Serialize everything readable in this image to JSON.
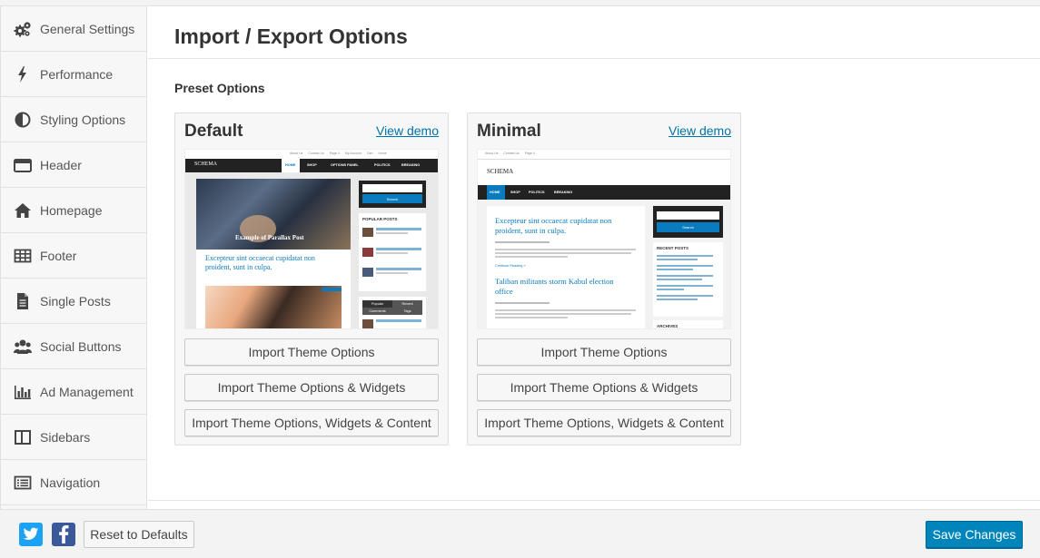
{
  "sidebar": {
    "items": [
      {
        "label": "General Settings",
        "icon": "gears-icon"
      },
      {
        "label": "Performance",
        "icon": "bolt-icon"
      },
      {
        "label": "Styling Options",
        "icon": "contrast-icon"
      },
      {
        "label": "Header",
        "icon": "header-icon"
      },
      {
        "label": "Homepage",
        "icon": "home-icon"
      },
      {
        "label": "Footer",
        "icon": "table-icon"
      },
      {
        "label": "Single Posts",
        "icon": "document-icon"
      },
      {
        "label": "Social Buttons",
        "icon": "users-icon"
      },
      {
        "label": "Ad Management",
        "icon": "bar-chart-icon"
      },
      {
        "label": "Sidebars",
        "icon": "columns-icon"
      },
      {
        "label": "Navigation",
        "icon": "list-icon"
      }
    ]
  },
  "main": {
    "title": "Import / Export Options",
    "section_label": "Preset Options",
    "presets": [
      {
        "name": "Default",
        "demo_label": "View demo",
        "thumb": {
          "logo": "SCHEMA",
          "menu": [
            "HOME",
            "SHOP",
            "OPTIONS PANEL",
            "POLITICS",
            "BREAKING"
          ],
          "top_links": [
            "About Us",
            "Contact Us",
            "Page 4",
            "My Account",
            "Cart",
            "Home"
          ],
          "hero_caption": "Example of Parallax Post",
          "post_title": "Excepteur sint occaecat cupidatat non proident, sunt in culpa.",
          "search_button": "Search",
          "widget_title": "POPULAR POSTS",
          "tab_popular": "Popular",
          "tab_recent": "Recent",
          "tab_comments": "Comments",
          "tab_tags": "Tags"
        },
        "buttons": [
          "Import Theme Options",
          "Import Theme Options & Widgets",
          "Import Theme Options, Widgets & Content"
        ]
      },
      {
        "name": "Minimal",
        "demo_label": "View demo",
        "thumb": {
          "logo": "SCHEMA",
          "menu": [
            "HOME",
            "SHOP",
            "POLITICS",
            "BREAKING"
          ],
          "top_links": [
            "About Us",
            "Contact Us",
            "Page 4"
          ],
          "post_title": "Excepteur sint occaecat cupidatat non proident, sunt in culpa.",
          "post_title_2": "Taliban militants storm Kabul election office",
          "continue": "Continue Reading »",
          "search_button": "Search",
          "widget_title": "RECENT POSTS",
          "widget_title_2": "ARCHIVES"
        },
        "buttons": [
          "Import Theme Options",
          "Import Theme Options & Widgets",
          "Import Theme Options, Widgets & Content"
        ]
      }
    ]
  },
  "footer": {
    "twitter_icon": "twitter-icon",
    "facebook_icon": "facebook-icon",
    "reset_label": "Reset to Defaults",
    "save_label": "Save Changes"
  },
  "colors": {
    "accent": "#0085ba",
    "link": "#0073aa",
    "twitter": "#1da1f2",
    "facebook": "#3b5998"
  }
}
